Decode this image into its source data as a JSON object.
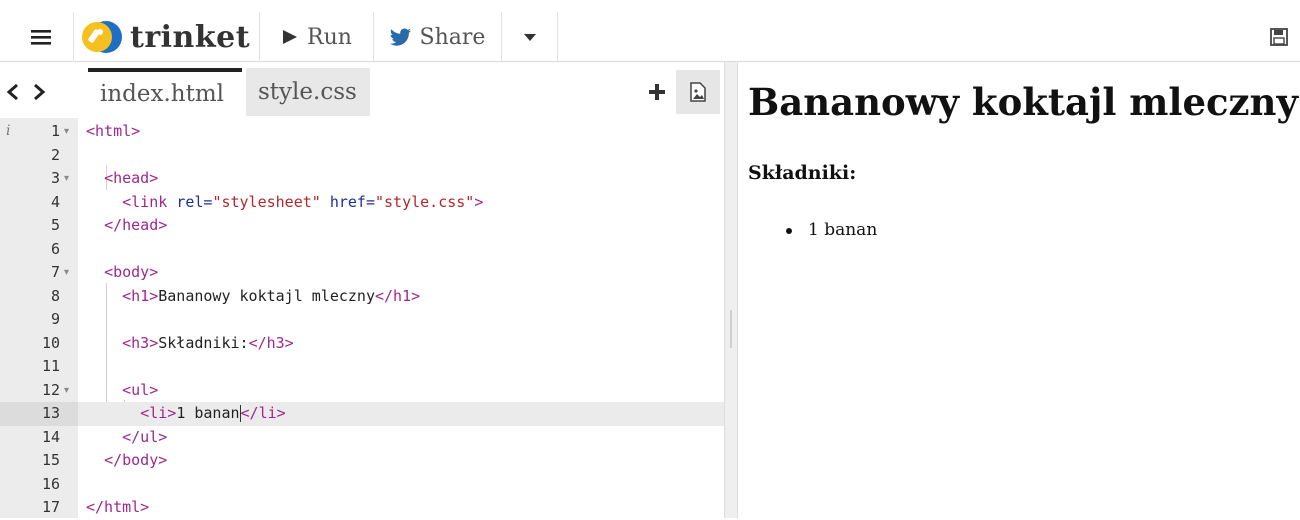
{
  "toolbar": {
    "brand": "trinket",
    "run_label": "Run",
    "share_label": "Share"
  },
  "colors": {
    "tag": "#a0268f",
    "attr": "#1f2c9e",
    "string": "#b5272b",
    "logo_yellow": "#f5c020",
    "logo_blue": "#1e6fc4",
    "share_blue": "#2a6aa8"
  },
  "icons": {
    "menu": "hamburger-icon",
    "run": "play-icon",
    "share": "bird-icon",
    "more": "caret-down-icon",
    "save": "floppy-icon",
    "add": "plus-icon",
    "image": "image-icon"
  },
  "editor": {
    "info_marker": "i",
    "tabs": [
      {
        "label": "index.html",
        "active": true
      },
      {
        "label": "style.css",
        "active": false
      }
    ],
    "active_line": 13,
    "lines": [
      {
        "n": "1",
        "fold": true,
        "tokens": [
          {
            "t": "tag",
            "v": "<html>"
          }
        ]
      },
      {
        "n": "2",
        "tokens": []
      },
      {
        "n": "3",
        "fold": true,
        "tokens": [
          {
            "t": "plain",
            "v": "  "
          },
          {
            "t": "tag",
            "v": "<head>"
          }
        ]
      },
      {
        "n": "4",
        "tokens": [
          {
            "t": "plain",
            "v": "    "
          },
          {
            "t": "tag",
            "v": "<link "
          },
          {
            "t": "attr",
            "v": "rel="
          },
          {
            "t": "str",
            "v": "\"stylesheet\""
          },
          {
            "t": "attr",
            "v": " href="
          },
          {
            "t": "str",
            "v": "\"style.css\""
          },
          {
            "t": "tag",
            "v": ">"
          }
        ]
      },
      {
        "n": "5",
        "tokens": [
          {
            "t": "plain",
            "v": "  "
          },
          {
            "t": "tag",
            "v": "</head>"
          }
        ]
      },
      {
        "n": "6",
        "tokens": []
      },
      {
        "n": "7",
        "fold": true,
        "tokens": [
          {
            "t": "plain",
            "v": "  "
          },
          {
            "t": "tag",
            "v": "<body>"
          }
        ]
      },
      {
        "n": "8",
        "tokens": [
          {
            "t": "plain",
            "v": "    "
          },
          {
            "t": "tag",
            "v": "<h1>"
          },
          {
            "t": "plain",
            "v": "Bananowy koktajl mleczny"
          },
          {
            "t": "tag",
            "v": "</h1>"
          }
        ]
      },
      {
        "n": "9",
        "tokens": []
      },
      {
        "n": "10",
        "tokens": [
          {
            "t": "plain",
            "v": "    "
          },
          {
            "t": "tag",
            "v": "<h3>"
          },
          {
            "t": "plain",
            "v": "Składniki:"
          },
          {
            "t": "tag",
            "v": "</h3>"
          }
        ]
      },
      {
        "n": "11",
        "tokens": []
      },
      {
        "n": "12",
        "fold": true,
        "tokens": [
          {
            "t": "plain",
            "v": "    "
          },
          {
            "t": "tag",
            "v": "<ul>"
          }
        ]
      },
      {
        "n": "13",
        "tokens": [
          {
            "t": "plain",
            "v": "      "
          },
          {
            "t": "tag",
            "v": "<li>"
          },
          {
            "t": "plain",
            "v": "1 banan"
          },
          {
            "t": "cursor",
            "v": ""
          },
          {
            "t": "tag",
            "v": "</li>"
          }
        ]
      },
      {
        "n": "14",
        "tokens": [
          {
            "t": "plain",
            "v": "    "
          },
          {
            "t": "tag",
            "v": "</ul>"
          }
        ]
      },
      {
        "n": "15",
        "tokens": [
          {
            "t": "plain",
            "v": "  "
          },
          {
            "t": "tag",
            "v": "</body>"
          }
        ]
      },
      {
        "n": "16",
        "tokens": []
      },
      {
        "n": "17",
        "tokens": [
          {
            "t": "tag",
            "v": "</html>"
          }
        ]
      }
    ]
  },
  "preview": {
    "h1": "Bananowy koktajl mleczny",
    "h3": "Składniki:",
    "list": [
      "1 banan"
    ]
  }
}
